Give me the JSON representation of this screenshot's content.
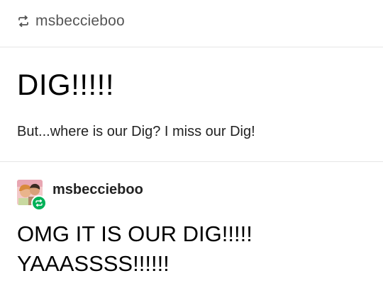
{
  "reblog_header": {
    "icon": "reblog-icon",
    "username": "msbeccieboo"
  },
  "original_post": {
    "title": "DIG!!!!!",
    "body": "But...where is our Dig? I miss our Dig!"
  },
  "reblog": {
    "avatar_icon": "avatar",
    "badge_icon": "reblog-badge-icon",
    "username": "msbeccieboo",
    "lines": [
      "OMG IT IS OUR DIG!!!!!",
      "YAAASSSS!!!!!!"
    ]
  },
  "colors": {
    "badge_green": "#00b158",
    "divider": "#e6e6e6",
    "header_text": "#555555"
  }
}
